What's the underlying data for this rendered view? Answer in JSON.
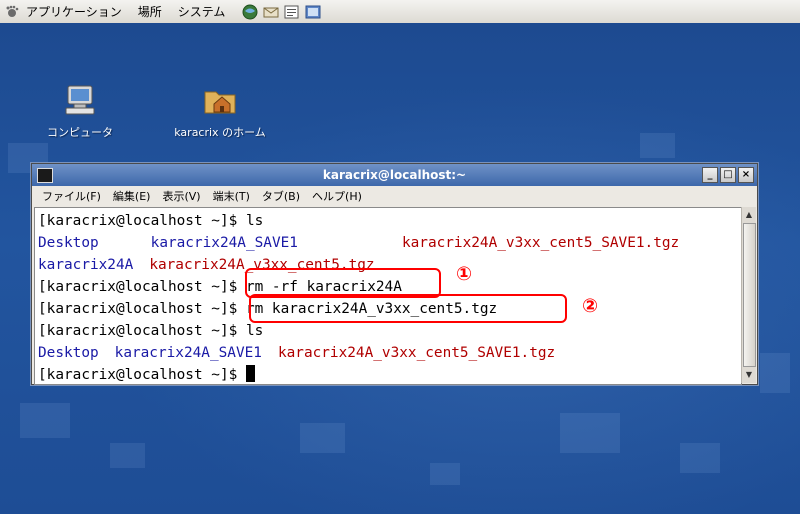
{
  "panel": {
    "menus": [
      "アプリケーション",
      "場所",
      "システム"
    ],
    "launchers": [
      "browser-icon",
      "mail-icon",
      "editor-icon",
      "gear-icon"
    ]
  },
  "desktop": {
    "icons": [
      {
        "label": "コンピュータ",
        "icon": "computer-icon"
      },
      {
        "label": "karacrix のホーム",
        "icon": "home-folder-icon"
      }
    ]
  },
  "window": {
    "title": "karacrix@localhost:~",
    "controls": {
      "minimize": "_",
      "maximize": "□",
      "close": "×"
    },
    "menu": [
      "ファイル(F)",
      "編集(E)",
      "表示(V)",
      "端末(T)",
      "タブ(B)",
      "ヘルプ(H)"
    ]
  },
  "terminal": {
    "prompt": "[karacrix@localhost ~]$ ",
    "lines": [
      {
        "cmd": "ls"
      },
      {
        "out": [
          "Desktop",
          "karacrix24A_SAVE1",
          "karacrix24A_v3xx_cent5_SAVE1.tgz"
        ]
      },
      {
        "out": [
          "karacrix24A",
          "karacrix24A_v3xx_cent5.tgz"
        ]
      },
      {
        "cmd": "rm -rf karacrix24A"
      },
      {
        "cmd": "rm karacrix24A_v3xx_cent5.tgz"
      },
      {
        "cmd": "ls"
      },
      {
        "out": [
          "Desktop",
          "karacrix24A_SAVE1",
          "karacrix24A_v3xx_cent5_SAVE1.tgz"
        ]
      },
      {
        "cmd": ""
      }
    ]
  },
  "annotations": [
    "①",
    "②"
  ],
  "colors": {
    "dir": "#1a1aa6",
    "archive": "#b00000",
    "annotation": "#ff0000",
    "desktop": "#1f4d96"
  }
}
